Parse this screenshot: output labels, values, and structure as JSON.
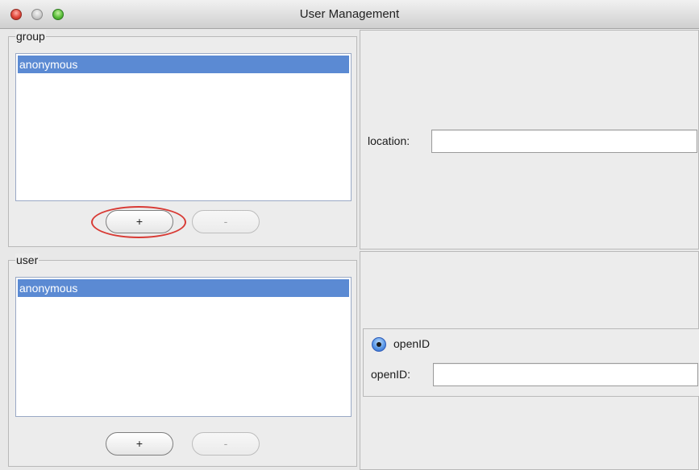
{
  "window": {
    "title": "User Management"
  },
  "group_panel": {
    "legend": "group",
    "items": [
      "anonymous"
    ],
    "add_label": "+",
    "remove_label": "-"
  },
  "user_panel": {
    "legend": "user",
    "items": [
      "anonymous"
    ],
    "add_label": "+",
    "remove_label": "-"
  },
  "location_panel": {
    "label": "location:",
    "value": ""
  },
  "auth_panel": {
    "radio_label": "openID",
    "radio_selected": true,
    "field_label": "openID:",
    "value": ""
  },
  "colors": {
    "selection": "#5b8ad3",
    "highlight_ring": "#d83a34"
  }
}
